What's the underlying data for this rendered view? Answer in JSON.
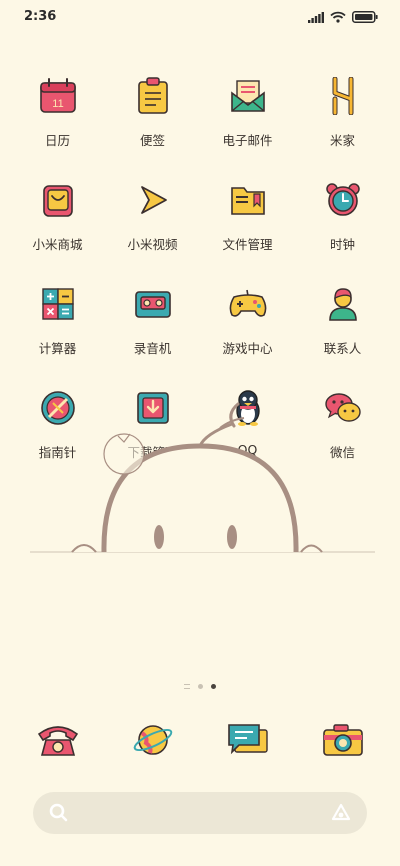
{
  "status_bar": {
    "time": "2:36"
  },
  "apps": [
    {
      "name": "calendar-app",
      "icon": "calendar-icon",
      "label": "日历",
      "badge": "11"
    },
    {
      "name": "notes-app",
      "icon": "notes-icon",
      "label": "便签"
    },
    {
      "name": "email-app",
      "icon": "email-icon",
      "label": "电子邮件"
    },
    {
      "name": "mijia-app",
      "icon": "mijia-icon",
      "label": "米家"
    },
    {
      "name": "mi-store-app",
      "icon": "shopping-bag-icon",
      "label": "小米商城"
    },
    {
      "name": "mi-video-app",
      "icon": "play-icon",
      "label": "小米视频"
    },
    {
      "name": "file-manager-app",
      "icon": "folder-icon",
      "label": "文件管理"
    },
    {
      "name": "clock-app",
      "icon": "alarm-clock-icon",
      "label": "时钟"
    },
    {
      "name": "calculator-app",
      "icon": "calculator-icon",
      "label": "计算器"
    },
    {
      "name": "recorder-app",
      "icon": "cassette-icon",
      "label": "录音机"
    },
    {
      "name": "game-center-app",
      "icon": "gamepad-icon",
      "label": "游戏中心"
    },
    {
      "name": "contacts-app",
      "icon": "person-icon",
      "label": "联系人"
    },
    {
      "name": "compass-app",
      "icon": "compass-icon",
      "label": "指南针"
    },
    {
      "name": "downloads-app",
      "icon": "download-icon",
      "label": "下载管理"
    },
    {
      "name": "qq-app",
      "icon": "penguin-icon",
      "label": "QQ"
    },
    {
      "name": "wechat-app",
      "icon": "chat-bubbles-icon",
      "label": "微信"
    }
  ],
  "dock": [
    {
      "name": "phone-app",
      "icon": "telephone-icon"
    },
    {
      "name": "browser-app",
      "icon": "planet-icon"
    },
    {
      "name": "messages-app",
      "icon": "message-icon"
    },
    {
      "name": "camera-app",
      "icon": "camera-icon"
    }
  ],
  "pager": {
    "pages": 2,
    "current": 2
  },
  "search": {
    "placeholder": ""
  },
  "colors": {
    "background": "#fdf8e6",
    "outline": "#a88f83"
  }
}
